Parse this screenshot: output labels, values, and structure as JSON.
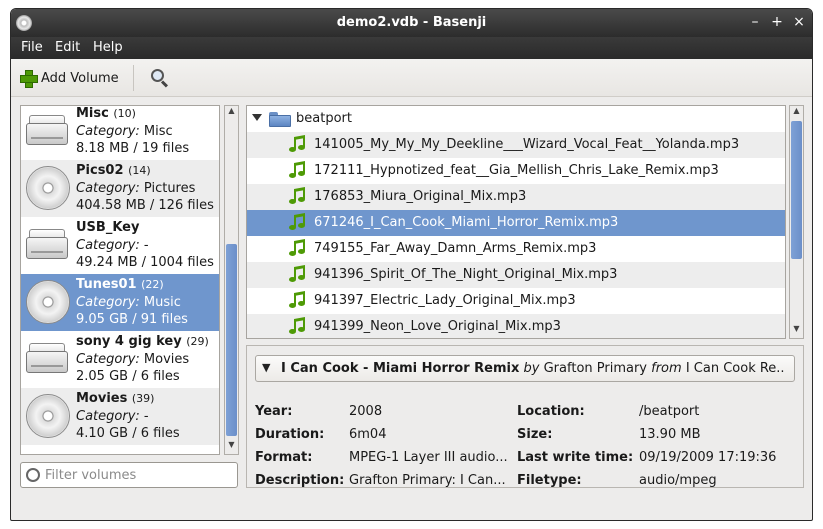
{
  "window": {
    "title": "demo2.vdb - Basenji"
  },
  "titlebar_buttons": {
    "minimize": "–",
    "maximize": "+",
    "close": "×"
  },
  "menu": {
    "file": "File",
    "edit": "Edit",
    "help": "Help"
  },
  "toolbar": {
    "add_volume": "Add Volume"
  },
  "volumes": [
    {
      "name": "Misc",
      "count": "(10)",
      "category_label": "Category:",
      "category": "Misc",
      "size": "8.18 MB / 19 files",
      "icon": "hard-drive-icon"
    },
    {
      "name": "Pics02",
      "count": "(14)",
      "category_label": "Category:",
      "category": "Pictures",
      "size": "404.58 MB / 126 files",
      "icon": "cd-icon"
    },
    {
      "name": "USB_Key",
      "count": "",
      "category_label": "Category:",
      "category": "-",
      "size": "49.24 MB / 1004 files",
      "icon": "hard-drive-icon"
    },
    {
      "name": "Tunes01",
      "count": "(22)",
      "category_label": "Category:",
      "category": "Music",
      "size": "9.05 GB / 91 files",
      "icon": "cd-icon"
    },
    {
      "name": "sony 4 gig key",
      "count": "(29)",
      "category_label": "Category:",
      "category": "Movies",
      "size": "2.05 GB / 6 files",
      "icon": "hard-drive-icon"
    },
    {
      "name": "Movies",
      "count": "(39)",
      "category_label": "Category:",
      "category": "-",
      "size": "4.10 GB / 6 files",
      "icon": "cd-icon"
    }
  ],
  "filter": {
    "placeholder": "Filter volumes"
  },
  "tree": {
    "folder": "beatport",
    "files": [
      "141005_My_My_My_Deekline___Wizard_Vocal_Feat__Yolanda.mp3",
      "172111_Hypnotized_feat__Gia_Mellish_Chris_Lake_Remix.mp3",
      "176853_Miura_Original_Mix.mp3",
      "671246_I_Can_Cook_Miami_Horror_Remix.mp3",
      "749155_Far_Away_Damn_Arms_Remix.mp3",
      "941396_Spirit_Of_The_Night_Original_Mix.mp3",
      "941397_Electric_Lady_Original_Mix.mp3",
      "941399_Neon_Love_Original_Mix.mp3"
    ]
  },
  "details": {
    "title": "I Can Cook - Miami Horror Remix",
    "by_word": "by",
    "artist": "Grafton Primary",
    "from_word": "from",
    "album": "I Can Cook Re...",
    "fields": {
      "year_label": "Year:",
      "year": "2008",
      "duration_label": "Duration:",
      "duration": "6m04",
      "format_label": "Format:",
      "format": "MPEG-1 Layer III audio...",
      "description_label": "Description:",
      "description": "Grafton Primary: I Can...",
      "location_label": "Location:",
      "location": "/beatport",
      "size_label": "Size:",
      "size": "13.90 MB",
      "lastwrite_label": "Last write time:",
      "lastwrite": "09/19/2009 17:19:36",
      "filetype_label": "Filetype:",
      "filetype": "audio/mpeg"
    }
  }
}
